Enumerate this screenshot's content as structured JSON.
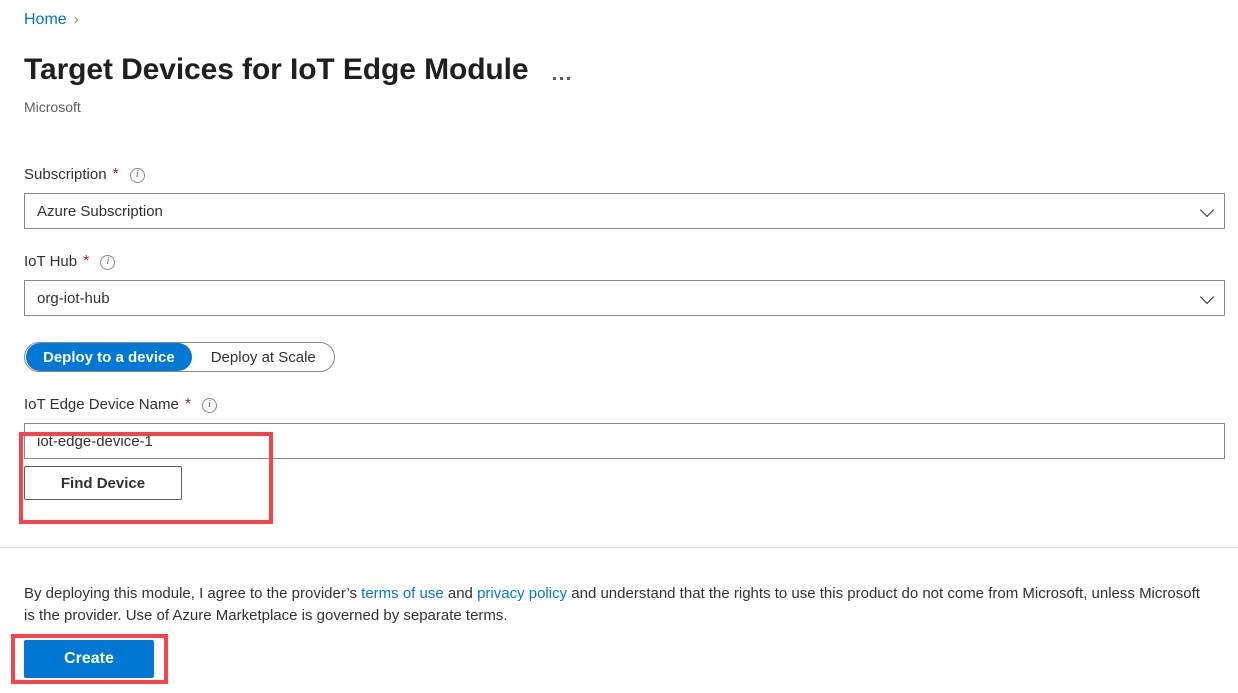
{
  "breadcrumb": {
    "home_label": "Home",
    "separator": "›"
  },
  "header": {
    "title": "Target Devices for IoT Edge Module",
    "publisher": "Microsoft",
    "more_menu_name": "more-options"
  },
  "form": {
    "subscription": {
      "label": "Subscription",
      "required_marker": "*",
      "value": "Azure Subscription"
    },
    "iot_hub": {
      "label": "IoT Hub",
      "required_marker": "*",
      "value": "org-iot-hub"
    },
    "pivot": {
      "options": [
        {
          "label": "Deploy to a device",
          "selected": true
        },
        {
          "label": "Deploy at Scale",
          "selected": false
        }
      ]
    },
    "device_name": {
      "label": "IoT Edge Device Name",
      "required_marker": "*",
      "value": "iot-edge-device-1",
      "placeholder": ""
    },
    "find_device_label": "Find Device"
  },
  "footer": {
    "text_part1": "By deploying this module, I agree to the provider’s ",
    "terms_link": "terms of use",
    "text_part2": " and ",
    "privacy_link": "privacy policy",
    "text_part3": " and understand that the rights to use this product do not come from Microsoft, unless Microsoft is the provider. Use of Azure Marketplace is governed by separate terms.",
    "create_label": "Create"
  },
  "colors": {
    "accent_blue": "#0078d4",
    "link_blue": "#0078d4",
    "required_red": "#a4262c",
    "annotation_red": "#f4444a",
    "border_grey": "#8a8886",
    "text_primary": "#323130",
    "text_secondary": "#605e5c"
  },
  "icons": {
    "info": "i",
    "chevron_down": "chevron-down-icon"
  }
}
